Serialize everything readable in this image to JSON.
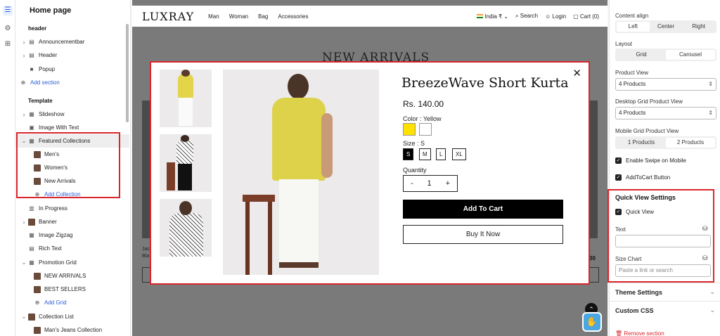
{
  "tree": {
    "title": "Home page",
    "items": [
      {
        "label": "header",
        "kind": "section"
      },
      {
        "label": "Announcementbar",
        "kind": "item",
        "chev": "›",
        "icon": "▤"
      },
      {
        "label": "Header",
        "kind": "item",
        "chev": "›",
        "icon": "▤"
      },
      {
        "label": "Popup",
        "kind": "item",
        "icon": "■"
      },
      {
        "label": "Add section",
        "kind": "link",
        "icon": "⊕"
      },
      {
        "label": "Template",
        "kind": "section"
      },
      {
        "label": "Slideshow",
        "kind": "item",
        "chev": "›",
        "icon": "▦"
      },
      {
        "label": "Image With Text",
        "kind": "item",
        "icon": "▣"
      },
      {
        "label": "Featured Collections",
        "kind": "item",
        "chev": "⌄",
        "icon": "▦",
        "selected": true
      },
      {
        "label": "Men's",
        "kind": "child",
        "icon": "img"
      },
      {
        "label": "Women's",
        "kind": "child",
        "icon": "img"
      },
      {
        "label": "New Arrivals",
        "kind": "child",
        "icon": "img"
      },
      {
        "label": "Add Collection",
        "kind": "childlink",
        "icon": "⊕"
      },
      {
        "label": "In Progress",
        "kind": "item",
        "icon": "▥"
      },
      {
        "label": "Banner",
        "kind": "item",
        "chev": "›",
        "icon": "img"
      },
      {
        "label": "Image Zigzag",
        "kind": "item",
        "icon": "▦"
      },
      {
        "label": "Rich Text",
        "kind": "item",
        "icon": "▤"
      },
      {
        "label": "Promotion Grid",
        "kind": "item",
        "chev": "⌄",
        "icon": "▦"
      },
      {
        "label": "NEW ARRIVALS",
        "kind": "child",
        "icon": "img"
      },
      {
        "label": "BEST SELLERS",
        "kind": "child",
        "icon": "img"
      },
      {
        "label": "Add Grid",
        "kind": "childlink",
        "icon": "⊕"
      },
      {
        "label": "Collection List",
        "kind": "item",
        "chev": "⌄",
        "icon": "img"
      },
      {
        "label": "Man's Jeans Collection",
        "kind": "child",
        "icon": "img"
      }
    ]
  },
  "store": {
    "logo": "LUXRAY",
    "nav": [
      "Man",
      "Woman",
      "Bag",
      "Accessories"
    ],
    "locale": "India ₹ ⌄",
    "search": "Search",
    "login": "Login",
    "cart": "Cart (0)",
    "bg_heading": "NEW ARRIVALS",
    "bg_text1": "Jac",
    "bg_text2": "Bla",
    "bg_price": "00"
  },
  "modal": {
    "title": "BreezeWave Short Kurta",
    "price": "Rs. 140.00",
    "color_label": "Color : Yellow",
    "colors": [
      "#ffe100",
      "#ffffff"
    ],
    "size_label": "Size : S",
    "sizes": [
      "S",
      "M",
      "L",
      "XL"
    ],
    "quantity_label": "Quantity",
    "qty_minus": "-",
    "qty_value": "1",
    "qty_plus": "+",
    "add_to_cart": "Add To Cart",
    "buy_now": "Buy It Now",
    "close": "✕"
  },
  "settings": {
    "content_align_label": "Content align",
    "content_align": [
      "Left",
      "Center",
      "Right"
    ],
    "layout_label": "Layout",
    "layout": [
      "Grid",
      "Carousel"
    ],
    "product_view_label": "Product View",
    "product_view": "4 Products",
    "desktop_grid_label": "Desktop Grid Product View",
    "desktop_grid": "4 Products",
    "mobile_grid_label": "Mobile Grid Product View",
    "mobile_grid": [
      "1 Products",
      "2 Products"
    ],
    "enable_swipe": "Enable Swipe on Mobile",
    "add_to_cart_button": "AddToCart Button",
    "quick_view_heading": "Quick View Settings",
    "quick_view": "Quick View",
    "text_label": "Text",
    "text_value": "",
    "size_chart_label": "Size Chart",
    "size_chart_placeholder": "Paste a link or search",
    "theme_settings": "Theme Settings",
    "custom_css": "Custom CSS",
    "remove_section": "Remove section"
  }
}
